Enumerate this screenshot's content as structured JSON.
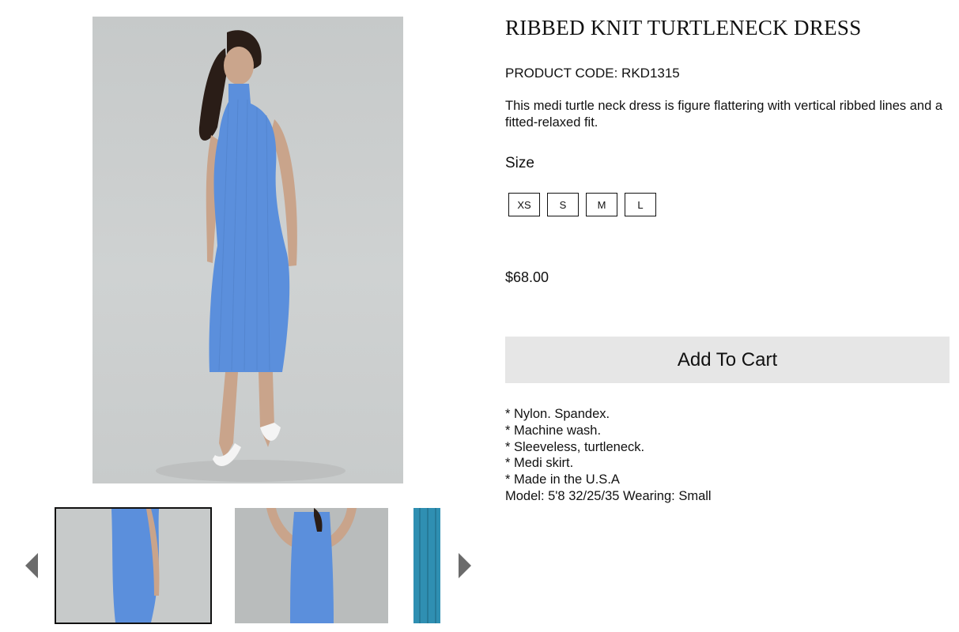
{
  "product": {
    "title": "RIBBED KNIT TURTLENECK DRESS",
    "code_label": "PRODUCT CODE:",
    "code_value": "RKD1315",
    "description": "This medi turtle neck dress is figure flattering with vertical ribbed lines and a fitted-relaxed fit.",
    "price": "$68.00"
  },
  "size": {
    "label": "Size",
    "options": [
      "XS",
      "S",
      "M",
      "L"
    ]
  },
  "cart": {
    "add_label": "Add To Cart"
  },
  "features": [
    "* Nylon. Spandex.",
    "* Machine wash.",
    "* Sleeveless, turtleneck.",
    "* Medi skirt.",
    "* Made in the U.S.A",
    "Model: 5'8 32/25/35 Wearing: Small"
  ],
  "gallery": {
    "main_image": "dress-photo",
    "thumbnails": [
      "thumb-full-body",
      "thumb-back-view",
      "thumb-fabric-detail"
    ],
    "selected_thumbnail": 1
  },
  "colors": {
    "dress": "#5b8fdc",
    "button_bg": "#e6e6e6",
    "photo_bg": "#c9cccc",
    "fabric_teal": "#2f8fb2"
  }
}
